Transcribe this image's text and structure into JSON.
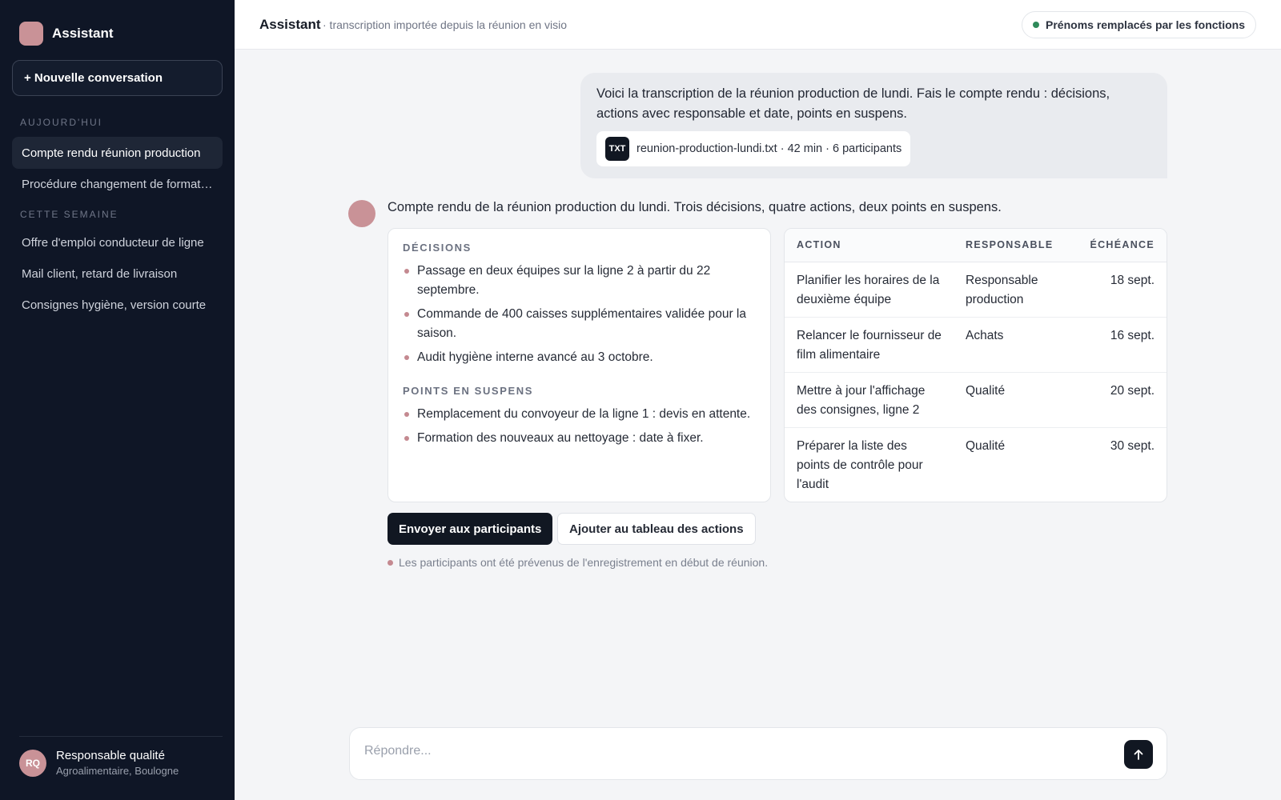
{
  "app": {
    "name": "Assistant"
  },
  "sidebar": {
    "new_chat_label": "+ Nouvelle conversation",
    "sections": [
      {
        "label": "AUJOURD'HUI",
        "items": [
          {
            "label": "Compte rendu réunion production"
          },
          {
            "label": "Procédure changement de format de carton"
          }
        ]
      },
      {
        "label": "CETTE SEMAINE",
        "items": [
          {
            "label": "Offre d'emploi conducteur de ligne"
          },
          {
            "label": "Mail client, retard de livraison"
          },
          {
            "label": "Consignes hygiène, version courte"
          }
        ]
      }
    ],
    "user": {
      "initials": "RQ",
      "name": "Responsable qualité",
      "org": "Agroalimentaire, Boulogne"
    }
  },
  "header": {
    "title": "Assistant",
    "subtitle": "· transcription importée depuis la réunion en visio",
    "privacy_badge": "Prénoms remplacés par les fonctions"
  },
  "user_message": {
    "text": "Voici la transcription de la réunion production de lundi. Fais le compte rendu : décisions, actions avec responsable et date, points en suspens.",
    "attachment": {
      "type_label": "TXT",
      "meta": "reunion-production-lundi.txt · 42 min · 6 participants"
    }
  },
  "assistant_message": {
    "intro": "Compte rendu de la réunion production du lundi. Trois décisions, quatre actions, deux points en suspens.",
    "decisions_heading": "DÉCISIONS",
    "decisions": [
      "Passage en deux équipes sur la ligne 2 à partir du 22 septembre.",
      "Commande de 400 caisses supplémentaires validée pour la saison.",
      "Audit hygiène interne avancé au 3 octobre."
    ],
    "pending_heading": "POINTS EN SUSPENS",
    "pending": [
      "Remplacement du convoyeur de la ligne 1 : devis en attente.",
      "Formation des nouveaux au nettoyage : date à fixer."
    ],
    "actions_table": {
      "headers": {
        "action": "ACTION",
        "owner": "RESPONSABLE",
        "due": "ÉCHÉANCE"
      },
      "rows": [
        {
          "action": "Planifier les horaires de la deuxième équipe",
          "owner": "Responsable production",
          "due": "18 sept."
        },
        {
          "action": "Relancer le fournisseur de film alimentaire",
          "owner": "Achats",
          "due": "16 sept."
        },
        {
          "action": "Mettre à jour l'affichage des consignes, ligne 2",
          "owner": "Qualité",
          "due": "20 sept."
        },
        {
          "action": "Préparer la liste des points de contrôle pour l'audit",
          "owner": "Qualité",
          "due": "30 sept."
        }
      ]
    },
    "primary_button": "Envoyer aux participants",
    "secondary_button": "Ajouter au tableau des actions",
    "notice": "Les participants ont été prévenus de l'enregistrement en début de réunion."
  },
  "composer": {
    "placeholder": "Répondre..."
  },
  "colors": {
    "sidebar_bg": "#0f1626",
    "accent_pink": "#c99297",
    "status_green": "#2f8a5a",
    "primary_dark": "#111722"
  },
  "icons": {
    "send": "arrow-up-icon",
    "file": "txt-file-icon"
  }
}
